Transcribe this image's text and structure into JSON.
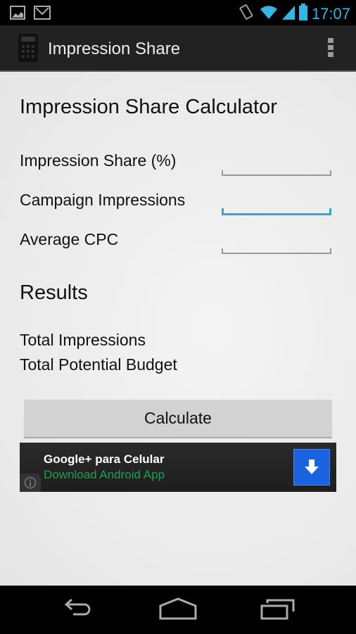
{
  "status_bar": {
    "time": "17:07",
    "left_icons": [
      "image-notification-icon",
      "gmail-notification-icon"
    ],
    "right_icons": [
      "vibrate-icon",
      "wifi-icon",
      "signal-icon",
      "battery-icon"
    ]
  },
  "action_bar": {
    "title": "Impression Share",
    "app_icon": "calculator-icon",
    "overflow_icon": "overflow-menu-icon"
  },
  "form": {
    "heading": "Impression Share Calculator",
    "fields": [
      {
        "label": "Impression Share (%)",
        "value": "",
        "focused": false
      },
      {
        "label": "Campaign Impressions",
        "value": "",
        "focused": true
      },
      {
        "label": "Average CPC",
        "value": "",
        "focused": false
      }
    ]
  },
  "results": {
    "heading": "Results",
    "items": [
      "Total Impressions",
      "Total Potential Budget"
    ]
  },
  "calculate_button": {
    "label": "Calculate"
  },
  "ad": {
    "title": "Google+ para Celular",
    "subtitle": "Download Android App",
    "download_icon": "download-icon",
    "info_icon": "info-icon",
    "colors": {
      "cta": "#1a63e0",
      "subtitle": "#17a349"
    }
  },
  "nav_bar": {
    "buttons": [
      "back",
      "home",
      "recent-apps"
    ]
  },
  "colors": {
    "accent": "#33b5e5",
    "focus": "#33a6d8"
  }
}
